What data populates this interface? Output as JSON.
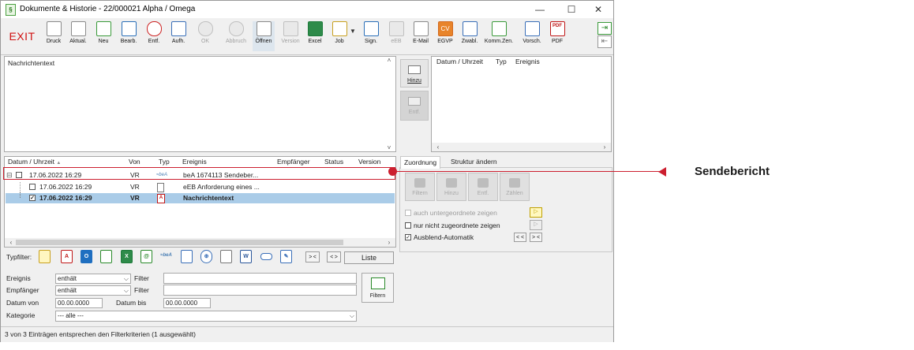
{
  "window": {
    "title": "Dokumente & Historie - 22/000021 Alpha / Omega",
    "app_icon": "§",
    "minimize": "—",
    "maximize": "☐",
    "close": "✕"
  },
  "toolbar": {
    "exit": "EXIT",
    "buttons": [
      {
        "label": "Druck",
        "icon": "printer-icon"
      },
      {
        "label": "Aktual.",
        "icon": "refresh-icon"
      },
      {
        "label": "Neu",
        "icon": "new-icon"
      },
      {
        "label": "Bearb.",
        "icon": "edit-icon"
      },
      {
        "label": "Entf.",
        "icon": "delete-icon"
      },
      {
        "label": "Aufh.",
        "icon": "structure-icon"
      },
      {
        "label": "OK",
        "icon": "ok-icon"
      },
      {
        "label": "Abbruch",
        "icon": "cancel-icon"
      },
      {
        "label": "Öffnen",
        "icon": "open-icon"
      },
      {
        "label": "Version",
        "icon": "version-icon"
      },
      {
        "label": "Excel",
        "icon": "excel-icon"
      },
      {
        "label": "Job",
        "icon": "job-icon"
      },
      {
        "label": "Sign.",
        "icon": "sign-icon"
      },
      {
        "label": "eEB",
        "icon": "eeb-icon"
      },
      {
        "label": "E-Mail",
        "icon": "email-icon"
      },
      {
        "label": "EGVP",
        "icon": "egvp-icon",
        "text": "CV"
      },
      {
        "label": "Zwabl.",
        "icon": "clipboard-icon"
      },
      {
        "label": "Komm.Zen.",
        "icon": "communication-icon"
      },
      {
        "label": "Vorsch.",
        "icon": "preview-icon"
      },
      {
        "label": "PDF",
        "icon": "pdf-icon",
        "text": "PDF"
      }
    ],
    "side_arrows": [
      "⇥",
      "⇤"
    ]
  },
  "message": {
    "text": "Nachrichtentext"
  },
  "side_buttons": [
    {
      "label": "Hinzu"
    },
    {
      "label": "Entf."
    }
  ],
  "right_table": {
    "headers": [
      "Datum / Uhrzeit",
      "Typ",
      "Ereignis"
    ]
  },
  "list": {
    "headers": [
      "Datum / Uhrzeit",
      "Von",
      "Typ",
      "Ereignis",
      "Empfänger",
      "Status",
      "Version"
    ],
    "sort_mark": "▲",
    "rows": [
      {
        "date": "17.06.2022 16:29",
        "from": "VR",
        "type": "beA",
        "event": "beA 1674113 Sendeber...",
        "recipient": "",
        "status": "",
        "version": "",
        "expander": "⊟",
        "checked": ""
      },
      {
        "date": "17.06.2022 16:29",
        "from": "VR",
        "type": "doc",
        "event": "eEB Anforderung eines ...",
        "recipient": "",
        "status": "",
        "version": "",
        "expander": "",
        "checked": ""
      },
      {
        "date": "17.06.2022 16:29",
        "from": "VR",
        "type": "pdf",
        "event": "Nachrichtentext",
        "recipient": "",
        "status": "",
        "version": "",
        "expander": "",
        "checked": "✓"
      }
    ]
  },
  "tabs": [
    {
      "label": "Zuordnung"
    },
    {
      "label": "Struktur ändern"
    }
  ],
  "zuordnung": {
    "buttons": [
      {
        "label": "Filtern"
      },
      {
        "label": "Hinzu"
      },
      {
        "label": "Entf."
      },
      {
        "label": "Zählen"
      }
    ],
    "options": [
      {
        "label": "auch untergeordnete zeigen",
        "checked": "",
        "enabled": false
      },
      {
        "label": "nur nicht zugeordnete zeigen",
        "checked": "",
        "enabled": true
      },
      {
        "label": "Ausblend-Automatik",
        "checked": "✓",
        "enabled": true
      }
    ],
    "nav": [
      "< <",
      "> <"
    ]
  },
  "filter": {
    "typfilter_label": "Typfilter:",
    "icons": [
      "note-icon",
      "pdf-icon",
      "outlook-icon",
      "folder-icon",
      "excel-icon",
      "at-icon",
      "bea-icon",
      "document-icon",
      "web-icon",
      "text-icon",
      "word-icon",
      "link-icon",
      "pen-icon"
    ],
    "nav_left": "> <",
    "nav_right": "< >",
    "list_button": "Liste",
    "event_label": "Ereignis",
    "event_op": "enthält",
    "recipient_label": "Empfänger",
    "recipient_op": "enthält",
    "filter_label": "Filter",
    "date_from_label": "Datum von",
    "date_from": "00.00.0000",
    "date_to_label": "Datum bis",
    "date_to": "00.00.0000",
    "category_label": "Kategorie",
    "category_value": "--- alle ---",
    "filter_button": "Filtern"
  },
  "status": {
    "text": "3 von 3 Einträgen entsprechen den Filterkriterien (1 ausgewählt)"
  },
  "annotation": {
    "label": "Sendebericht",
    "color": "#cc1f2f"
  }
}
